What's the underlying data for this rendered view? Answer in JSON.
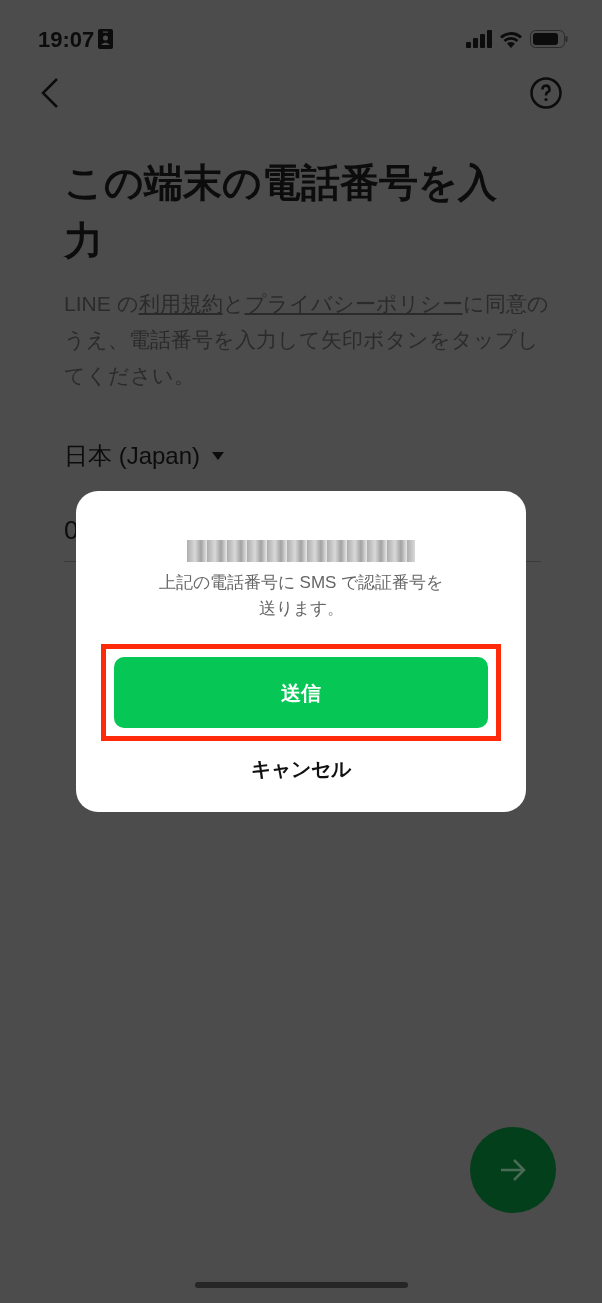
{
  "status_bar": {
    "time": "19:07"
  },
  "header": {
    "title": "この端末の電話番号を入力"
  },
  "intro": {
    "parts": [
      {
        "kind": "text",
        "text": "LINE の"
      },
      {
        "kind": "link",
        "text": "利用規約"
      },
      {
        "kind": "text",
        "text": "と"
      },
      {
        "kind": "link",
        "text": "プライバシーポリシー"
      },
      {
        "kind": "text",
        "text": "に同意のうえ、電話番号を入力して矢印ボタンをタップしてください。"
      }
    ]
  },
  "country": {
    "label": "日本 (Japan)"
  },
  "phone_field": {
    "value": "0"
  },
  "dialog": {
    "message": "上記の電話番号に SMS で認証番号を送ります。",
    "buttons": [
      {
        "kind": "primary",
        "label": "送信",
        "highlighted": true
      },
      {
        "kind": "plain",
        "label": "キャンセル",
        "highlighted": false
      }
    ]
  }
}
